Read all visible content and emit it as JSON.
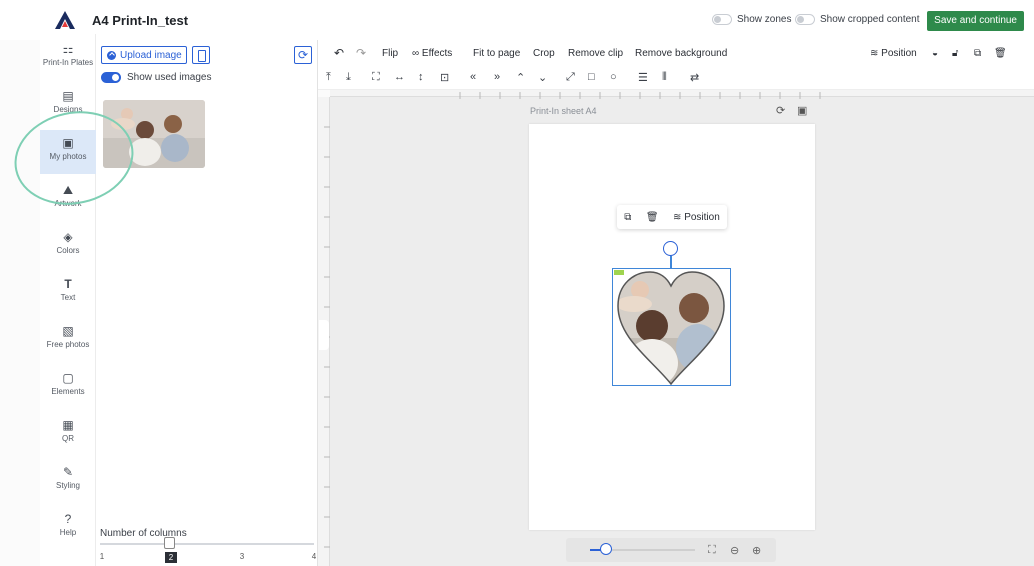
{
  "app": {
    "title": "A4 Print-In_test",
    "brand_color": "#1a2b5e"
  },
  "top_toggles": {
    "zones_label": "Show zones",
    "cropped_label": "Show cropped content"
  },
  "save_button": {
    "label": "Save and continue",
    "color": "#2e8a4b"
  },
  "rail": {
    "items": [
      {
        "label": "Print-In Plates",
        "icon": "plates-icon"
      },
      {
        "label": "Designs",
        "icon": "designs-icon"
      },
      {
        "label": "My photos",
        "icon": "photos-icon",
        "active": true
      },
      {
        "label": "Artwork",
        "icon": "artwork-icon"
      },
      {
        "label": "Colors",
        "icon": "colors-icon"
      },
      {
        "label": "Text",
        "icon": "text-icon"
      },
      {
        "label": "Free photos",
        "icon": "free-photos-icon"
      },
      {
        "label": "Elements",
        "icon": "elements-icon"
      },
      {
        "label": "QR",
        "icon": "qr-icon"
      },
      {
        "label": "Styling",
        "icon": "styling-icon"
      },
      {
        "label": "Help",
        "icon": "help-icon"
      }
    ]
  },
  "panel": {
    "upload_label": "Upload image",
    "used_toggle_label": "Show used images",
    "columns_label": "Number of columns",
    "columns_ticks": [
      "1",
      "2",
      "3",
      "4"
    ],
    "columns_selected": "2"
  },
  "toolbar": {
    "flip": "Flip",
    "effects": "Effects",
    "fit_to_page": "Fit to page",
    "crop": "Crop",
    "remove_clip": "Remove clip",
    "remove_background": "Remove background",
    "position": "Position"
  },
  "canvas": {
    "sheet_label": "Print-In sheet A4",
    "float_position_label": "Position"
  },
  "zoom": {
    "level_fraction": 0.15
  }
}
